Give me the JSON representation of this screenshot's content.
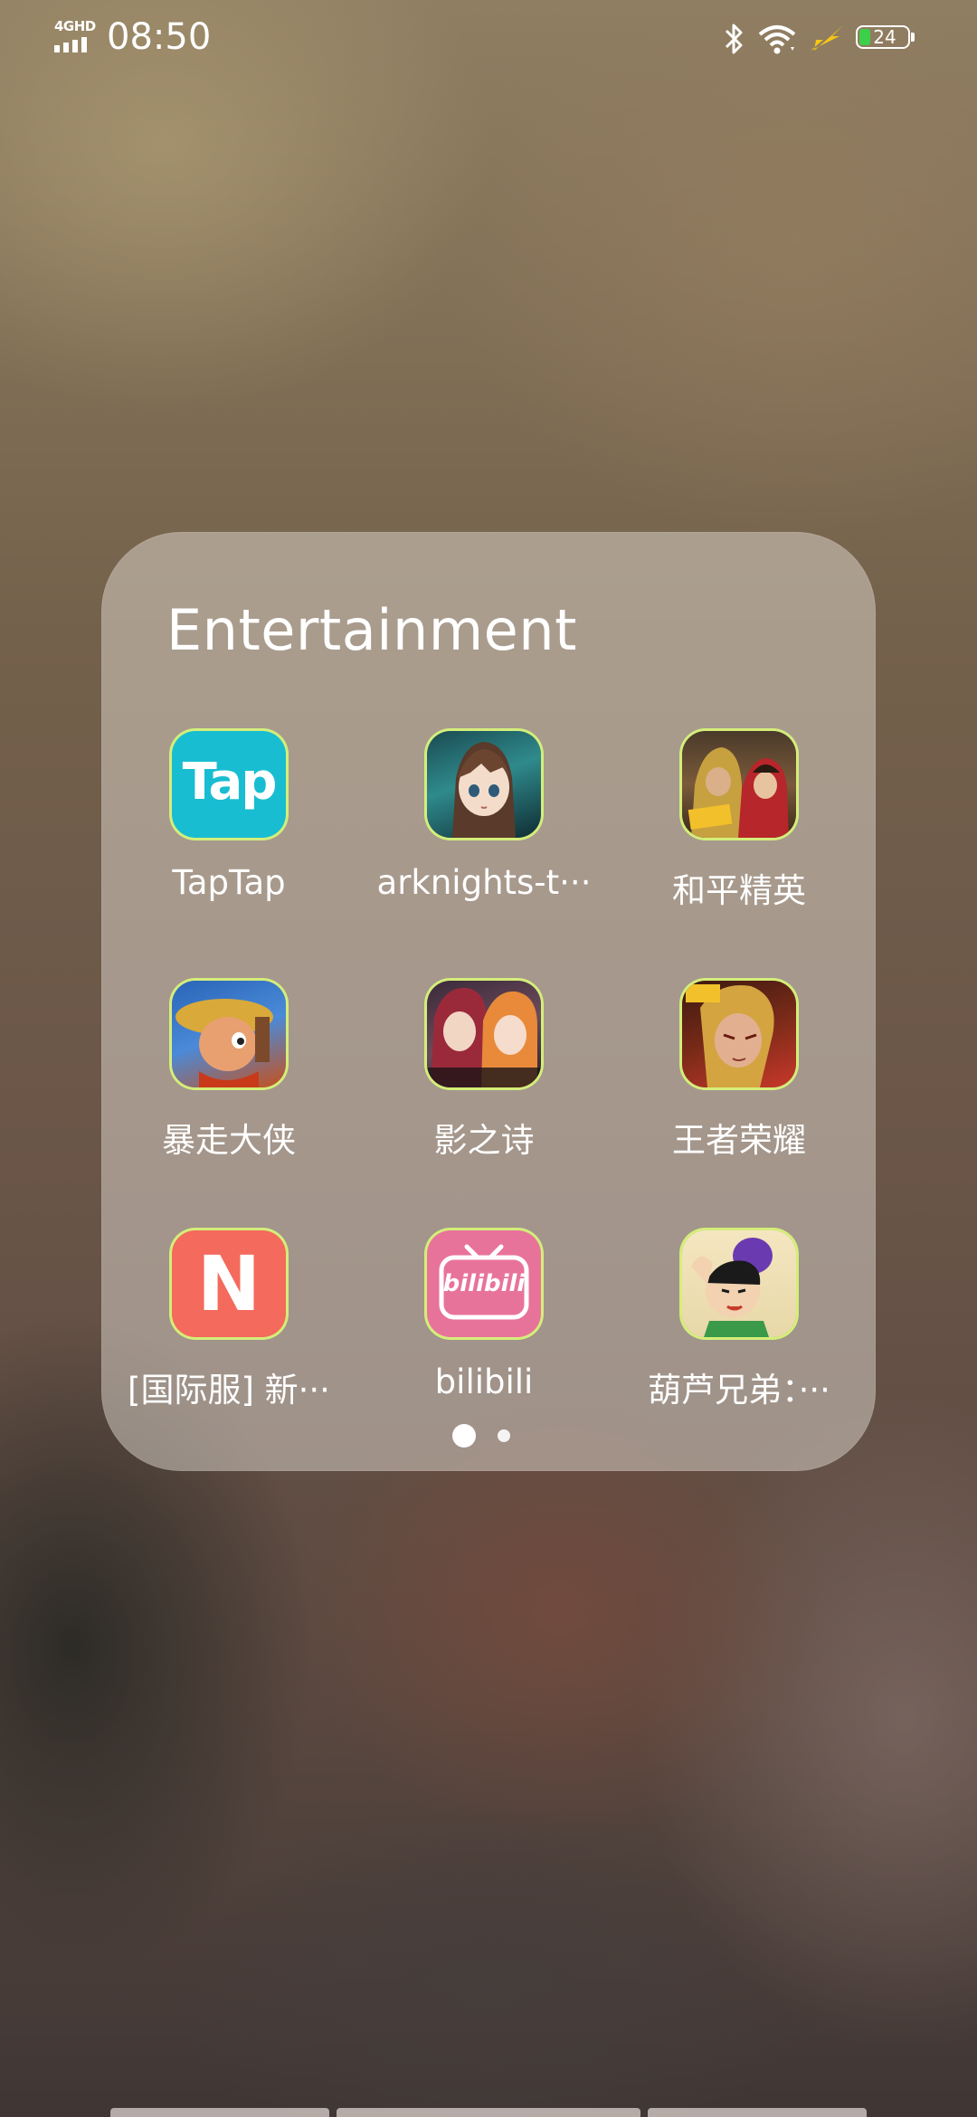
{
  "status_bar": {
    "network": "4GHD",
    "time": "08:50",
    "battery": "24",
    "icons": [
      "signal-icon",
      "bluetooth-icon",
      "wifi-icon",
      "power-saving-icon",
      "battery-icon"
    ]
  },
  "folder": {
    "title": "Entertainment",
    "apps": [
      {
        "label": "TapTap",
        "icon": "taptap-icon",
        "icon_text": "Tap"
      },
      {
        "label": "arknights-t···",
        "icon": "arknights-icon"
      },
      {
        "label": "和平精英",
        "icon": "peace-elite-icon"
      },
      {
        "label": "暴走大侠",
        "icon": "baozou-daxia-icon"
      },
      {
        "label": "影之诗",
        "icon": "shadowverse-icon"
      },
      {
        "label": "王者荣耀",
        "icon": "honor-of-kings-icon"
      },
      {
        "label": "[国际服] 新···",
        "icon": "news-n-icon",
        "icon_text": "N"
      },
      {
        "label": "bilibili",
        "icon": "bilibili-icon",
        "icon_text": "bilibili"
      },
      {
        "label": "葫芦兄弟：···",
        "icon": "calabash-brothers-icon"
      }
    ],
    "page_count": 2,
    "current_page": 1
  },
  "colors": {
    "icon_outline": "#d4ee7a",
    "taptap_bg": "#19bdd1",
    "news_bg": "#f46a5c",
    "bilibili_bg": "#e8739a",
    "battery_fill": "#3ccf4a",
    "bolt": "#f5c518"
  }
}
